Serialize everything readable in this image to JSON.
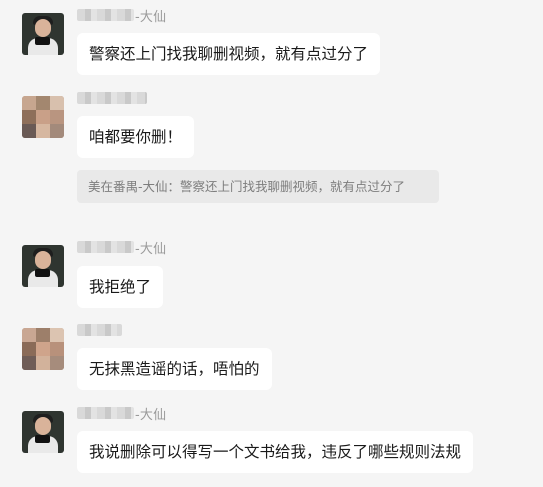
{
  "messages": [
    {
      "sender_suffix": "-大仙",
      "text": "警察还上门找我聊删视频，就有点过分了"
    },
    {
      "sender_suffix": "",
      "text": "咱都要你删！",
      "quote": {
        "text": "美在番禺-大仙：警察还上门找我聊删视频，就有点过分了"
      }
    },
    {
      "sender_suffix": "-大仙",
      "text": "我拒绝了"
    },
    {
      "sender_suffix": "",
      "text": "无抹黑造谣的话，唔怕的"
    },
    {
      "sender_suffix": "-大仙",
      "text": "我说删除可以得写一个文书给我，违反了哪些规则法规"
    }
  ]
}
